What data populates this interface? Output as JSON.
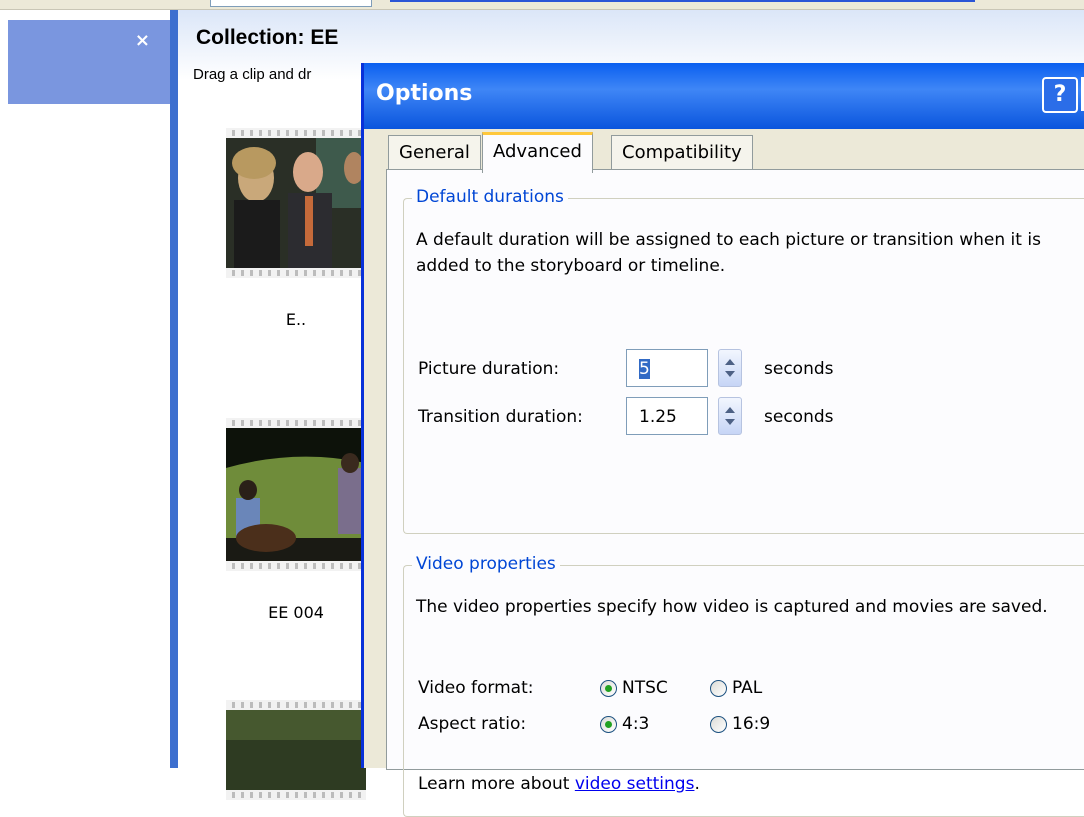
{
  "collection": {
    "title": "Collection: EE",
    "hint": "Drag a clip and dr",
    "clips": [
      {
        "label": "E.."
      },
      {
        "label": "EE 004"
      },
      {
        "label": ""
      }
    ]
  },
  "taskpane": {
    "close_glyph": "×"
  },
  "dialog": {
    "title": "Options",
    "help_glyph": "?",
    "tabs": [
      {
        "label": "General",
        "active": false
      },
      {
        "label": "Advanced",
        "active": true
      },
      {
        "label": "Compatibility",
        "active": false
      }
    ],
    "default_durations": {
      "legend": "Default durations",
      "description": "A default duration will be assigned to each picture or transition when it is added to the storyboard or timeline.",
      "picture_label": "Picture duration:",
      "picture_value": "5",
      "transition_label": "Transition duration:",
      "transition_value": "1.25",
      "units": "seconds"
    },
    "video_properties": {
      "legend": "Video properties",
      "description": "The video properties specify how video is captured and movies are saved.",
      "format_label": "Video format:",
      "format_options": [
        "NTSC",
        "PAL"
      ],
      "format_selected": "NTSC",
      "aspect_label": "Aspect ratio:",
      "aspect_options": [
        "4:3",
        "16:9"
      ],
      "aspect_selected": "4:3",
      "learn_prefix": "Learn more about ",
      "learn_link": "video settings",
      "learn_suffix": "."
    }
  },
  "colors": {
    "titlebar": "#0a5ff0",
    "legend_text": "#0046d5",
    "tab_highlight": "#ffc83c",
    "radio_dot": "#21a121",
    "taskpane_header": "#7a96df"
  }
}
